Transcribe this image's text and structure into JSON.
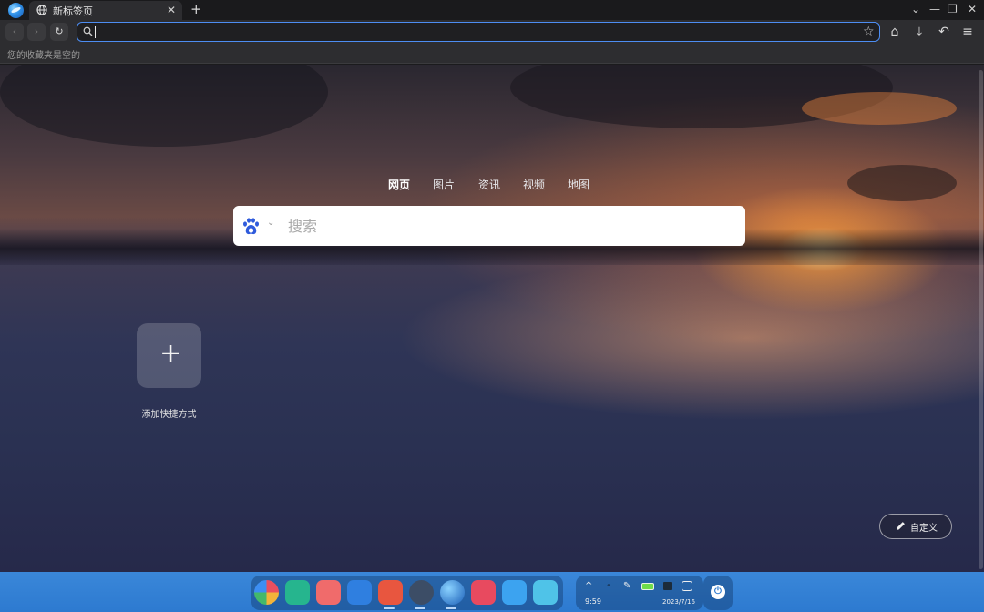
{
  "tabbar": {
    "tab_title": "新标签页",
    "tab_close": "✕",
    "new_tab": "+",
    "controls": {
      "dropdown": "⌄",
      "minimize": "—",
      "restore": "❐",
      "close": "✕"
    }
  },
  "navbar": {
    "back": "‹",
    "forward": "›",
    "reload": "↻",
    "url_value": "",
    "star": "☆",
    "icons": {
      "store": "⌂",
      "download": "⤓",
      "undo": "↶",
      "menu": "≡"
    }
  },
  "bookmarks": {
    "empty_text": "您的收藏夹是空的"
  },
  "search": {
    "tabs": [
      {
        "label": "网页",
        "active": true
      },
      {
        "label": "图片",
        "active": false
      },
      {
        "label": "资讯",
        "active": false
      },
      {
        "label": "视频",
        "active": false
      },
      {
        "label": "地图",
        "active": false
      }
    ],
    "engine": "baidu-icon",
    "engine_caret": "⌄",
    "placeholder": "搜索",
    "value": ""
  },
  "shortcuts": {
    "add_symbol": "+",
    "add_label": "添加快捷方式"
  },
  "customize": {
    "label": "自定义"
  },
  "taskbar": {
    "apps": [
      "launcher-icon",
      "file-manager-icon",
      "app-store-icon",
      "calendar-icon",
      "mail-icon",
      "settings-gear-icon",
      "browser-icon",
      "terminal-icon",
      "image-viewer-icon",
      "archive-manager-icon"
    ],
    "time": "9:59",
    "date": "2023/7/16",
    "tray_icons": {
      "chevron": "^",
      "network": "•",
      "pen": "✎"
    },
    "power": "⏻"
  },
  "colors": {
    "accent": "#4d8df2",
    "taskbar": "#2d7ad0",
    "chrome_bg": "#2d2d30"
  }
}
